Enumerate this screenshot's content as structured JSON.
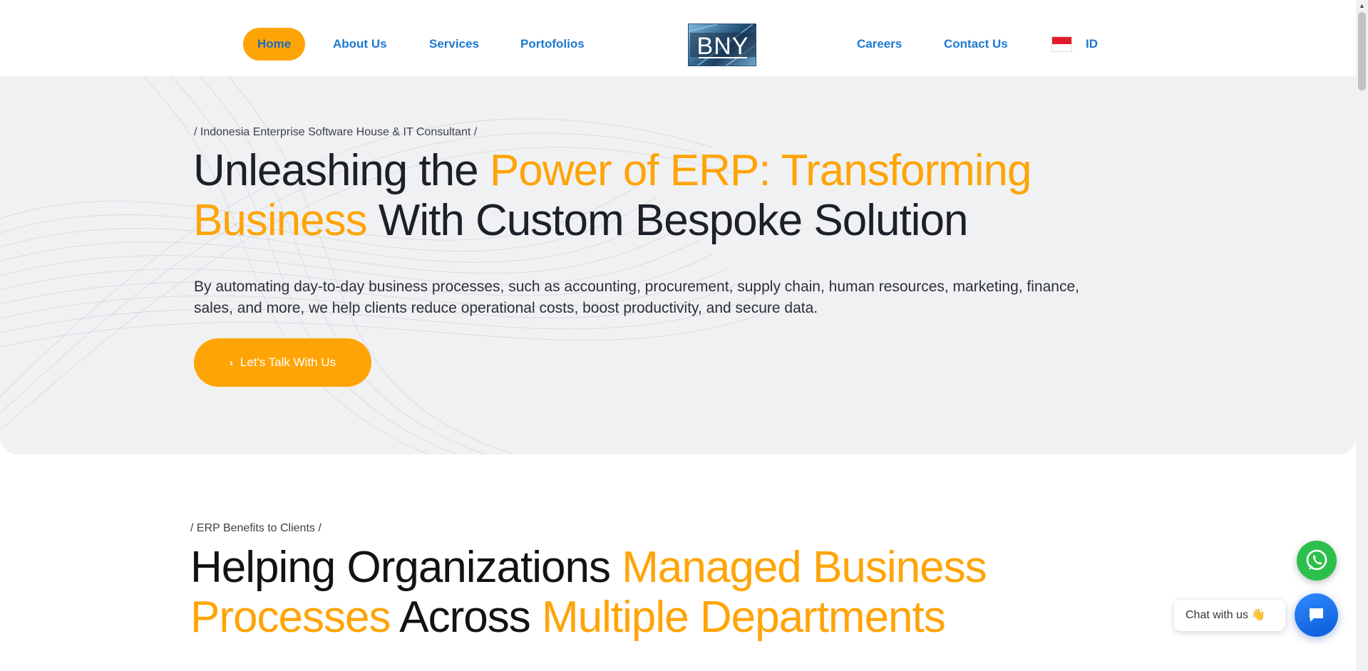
{
  "nav": {
    "home": "Home",
    "about": "About Us",
    "services": "Services",
    "portfolios": "Portofolios",
    "careers": "Careers",
    "contact": "Contact Us",
    "language": "ID",
    "logo_text": "BNY"
  },
  "hero": {
    "tagline": "/ Indonesia Enterprise Software House & IT Consultant  /",
    "title_part1": "Unleashing the ",
    "title_accent": "Power of ERP: Transforming Business",
    "title_part2": " With Custom Bespoke Solution",
    "description": "By automating day-to-day business processes, such as accounting, procurement, supply chain, human resources, marketing, finance, sales, and more, we help clients reduce operational costs, boost productivity, and secure data.",
    "cta_label": "Let's Talk With Us"
  },
  "benefits": {
    "tagline": "/ ERP Benefits to Clients /",
    "title_part1": "Helping Organizations ",
    "title_accent1": "Managed Business Processes",
    "title_part2": " Across ",
    "title_accent2": "Multiple Departments"
  },
  "widgets": {
    "chat_label": "Chat with us",
    "chat_emoji": "👋"
  },
  "colors": {
    "accent": "#ffa407",
    "link": "#1b78d0",
    "whatsapp": "#2dbf4c",
    "chat": "#1a6fe8"
  }
}
